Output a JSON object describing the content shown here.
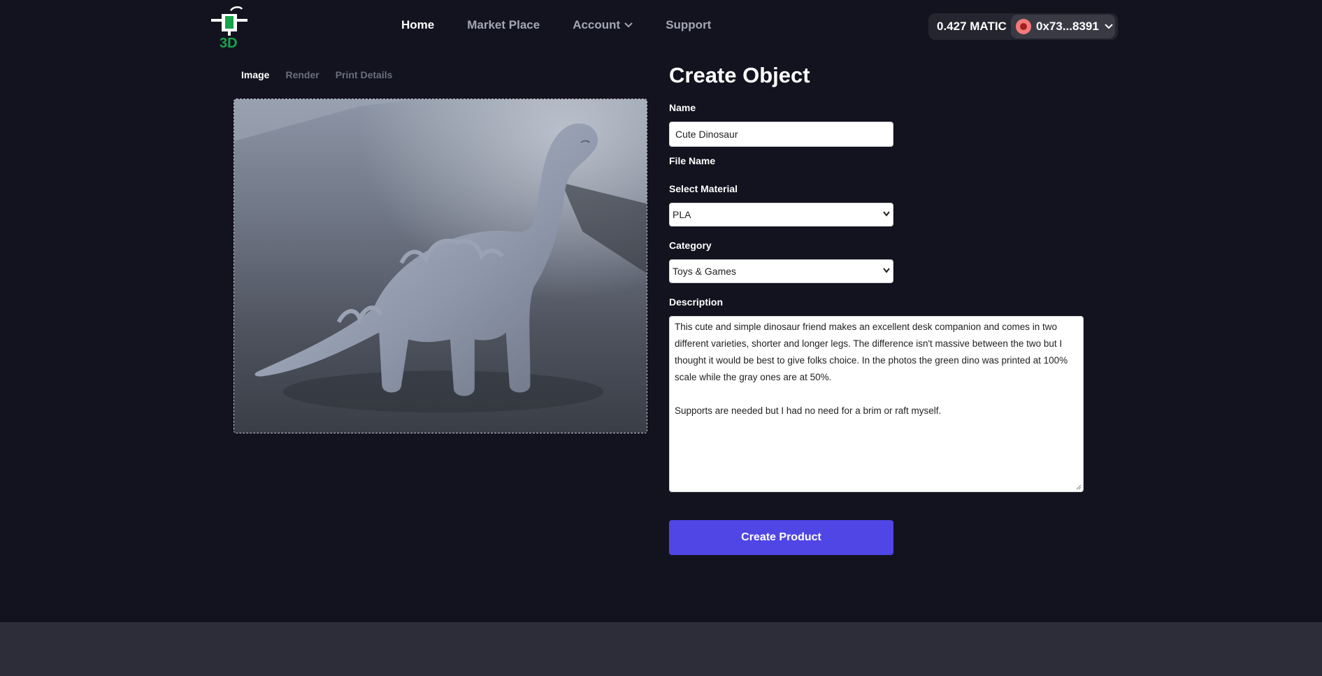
{
  "header": {
    "logo_icon": "3d-printer-logo",
    "logo_text": "3D",
    "nav": [
      {
        "label": "Home",
        "active": true
      },
      {
        "label": "Market Place",
        "active": false
      },
      {
        "label": "Account",
        "active": false,
        "has_dropdown": true
      },
      {
        "label": "Support",
        "active": false
      }
    ],
    "wallet": {
      "balance": "0.427 MATIC",
      "address": "0x73...8391",
      "avatar_icon": "watermelon-icon"
    }
  },
  "tabs": [
    {
      "label": "Image",
      "active": true
    },
    {
      "label": "Render",
      "active": false
    },
    {
      "label": "Print Details",
      "active": false
    }
  ],
  "preview": {
    "image_icon": "dinosaur-photo"
  },
  "form": {
    "title": "Create Object",
    "name_label": "Name",
    "name_value": "Cute Dinosaur",
    "file_name_label": "File Name",
    "material_label": "Select Material",
    "material_value": "PLA",
    "category_label": "Category",
    "category_value": "Toys & Games",
    "description_label": "Description",
    "description_paragraph_1": "This cute and simple dinosaur friend makes an excellent desk companion and comes in two different varieties, shorter and longer legs. The difference isn't massive between the two but I thought it would be best to give folks choice. In the photos the green dino was printed at 100% scale while the gray ones are at 50%.",
    "description_paragraph_2": "Supports are needed but I had no need for a brim or raft myself.",
    "submit_label": "Create Product"
  },
  "colors": {
    "background": "#13131f",
    "accent": "#4f46e5",
    "wallet_bg": "#25252f",
    "footer_bg": "#2d2d3a"
  }
}
